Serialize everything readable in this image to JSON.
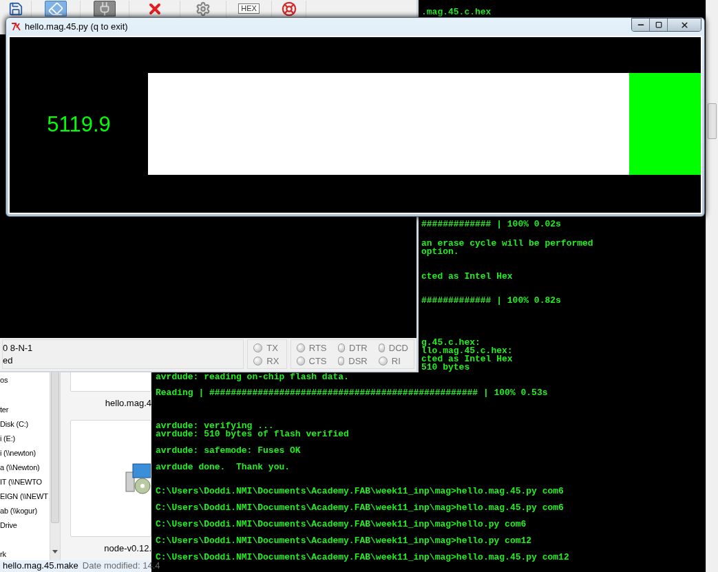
{
  "terminal": {
    "partial_blocks": [
      [
        ".mag.45.c.hex"
      ],
      [
        "############# | 100% 0.02s"
      ],
      [
        "an erase cycle will be performed",
        "option."
      ],
      [
        "cted as Intel Hex"
      ],
      [
        "############# | 100% 0.82s"
      ],
      [
        "g.45.c.hex:",
        "llo.mag.45.c.hex:",
        "cted as Intel Hex",
        "510 bytes"
      ]
    ],
    "blocks": [
      [
        "avrdude: reading on-chip flash data."
      ],
      [
        "Reading | ################################################## | 100% 0.53s"
      ],
      [
        "avrdude: verifying ...",
        "avrdude: 510 bytes of flash verified"
      ],
      [
        "avrdude: safemode: Fuses OK"
      ],
      [
        "avrdude done.  Thank you."
      ],
      [
        "C:\\Users\\Doddi.NMI\\Documents\\Academy.FAB\\week11_inp\\mag>hello.mag.45.py com6"
      ],
      [
        "C:\\Users\\Doddi.NMI\\Documents\\Academy.FAB\\week11_inp\\mag>hello.mag.45.py com6"
      ],
      [
        "C:\\Users\\Doddi.NMI\\Documents\\Academy.FAB\\week11_inp\\mag>hello.py com6"
      ],
      [
        "C:\\Users\\Doddi.NMI\\Documents\\Academy.FAB\\week11_inp\\mag>hello.py com12"
      ],
      [
        "C:\\Users\\Doddi.NMI\\Documents\\Academy.FAB\\week11_inp\\mag>hello.mag.45.py com12"
      ]
    ]
  },
  "explorer": {
    "nav_items": [
      "os",
      "ter",
      "Disk (C:)",
      "i (E:)",
      "i (\\\\newton)",
      "a (\\\\Newton)",
      "IT (\\\\NEWTO",
      "EIGN (\\\\NEWT",
      "ab (\\\\kogur)",
      "Drive",
      "rk"
    ],
    "files": [
      {
        "kind": "blank",
        "name": "hello.mag.4"
      },
      {
        "kind": "installer",
        "name": "node-v0.12."
      }
    ],
    "details": {
      "name": "hello.mag.45.make",
      "modified": "Date modified: 14.4"
    }
  },
  "serial_monitor": {
    "toolbar": [
      {
        "kind": "save",
        "selected": false,
        "pressed": false
      },
      {
        "kind": "eraser",
        "selected": true,
        "pressed": false
      },
      {
        "kind": "plug",
        "selected": false,
        "pressed": true
      },
      {
        "kind": "clear",
        "selected": false,
        "pressed": false
      },
      {
        "kind": "options",
        "selected": false,
        "pressed": false
      },
      {
        "kind": "text",
        "label": "HEX",
        "selected": false,
        "pressed": false
      },
      {
        "kind": "help",
        "selected": false,
        "pressed": false
      }
    ],
    "status_lines": [
      "0 8-N-1",
      "ed"
    ],
    "led_groups": [
      [
        {
          "label": "TX",
          "on": false
        },
        {
          "label": "RX",
          "on": false
        }
      ],
      [
        {
          "label": "RTS",
          "on": false
        },
        {
          "label": "DTR",
          "on": false
        },
        {
          "label": "DCD",
          "on": false
        },
        {
          "label": "CTS",
          "on": false
        },
        {
          "label": "DSR",
          "on": false
        },
        {
          "label": "RI",
          "on": false
        }
      ]
    ]
  },
  "plot_window": {
    "title": "hello.mag.45.py (q to exit)",
    "reading": "5119.9",
    "meter": {
      "level": 0.13
    }
  }
}
